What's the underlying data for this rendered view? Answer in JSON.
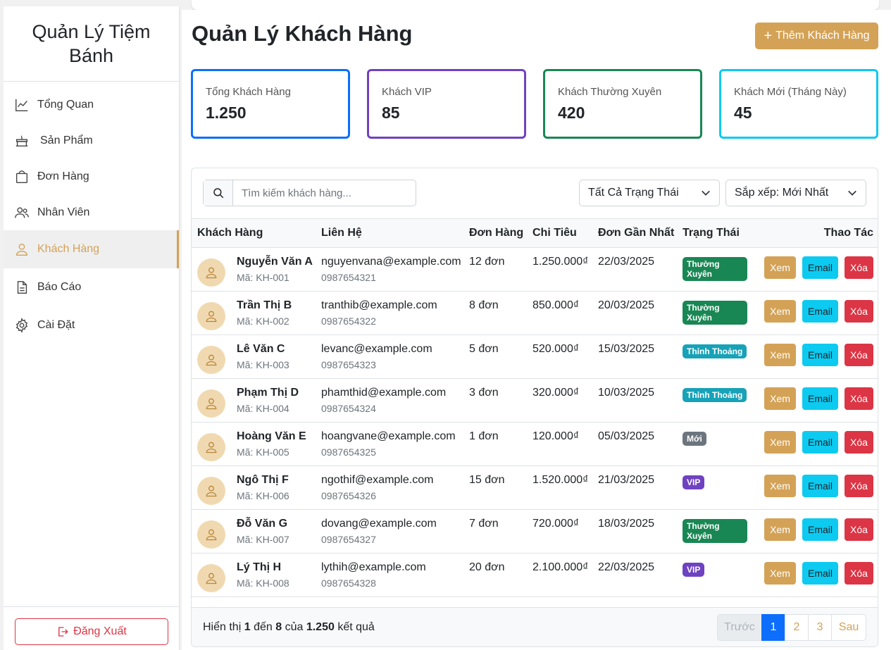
{
  "sidebar": {
    "brand": "Quản Lý Tiệm Bánh",
    "items": [
      {
        "label": "Tổng Quan",
        "icon": "chart-line-icon"
      },
      {
        "label": "Sản Phẩm",
        "icon": "cake-icon"
      },
      {
        "label": "Đơn Hàng",
        "icon": "shopping-bag-icon"
      },
      {
        "label": "Nhân Viên",
        "icon": "users-icon"
      },
      {
        "label": "Khách Hàng",
        "icon": "user-icon",
        "active": true
      },
      {
        "label": "Báo Cáo",
        "icon": "file-icon"
      },
      {
        "label": "Cài Đặt",
        "icon": "gear-icon"
      }
    ],
    "logout_label": "Đăng Xuất"
  },
  "header": {
    "title": "Quản Lý Khách Hàng",
    "add_button_label": "Thêm Khách Hàng"
  },
  "stats": [
    {
      "label": "Tổng Khách Hàng",
      "value": "1.250",
      "color": "#0d6efd"
    },
    {
      "label": "Khách VIP",
      "value": "85",
      "color": "#6f42c1"
    },
    {
      "label": "Khách Thường Xuyên",
      "value": "420",
      "color": "#198754"
    },
    {
      "label": "Khách Mới (Tháng Này)",
      "value": "45",
      "color": "#0dcaf0"
    }
  ],
  "filters": {
    "search_placeholder": "Tìm kiếm khách hàng...",
    "status_select": "Tất Cả Trạng Thái",
    "sort_select": "Sắp xếp: Mới Nhất"
  },
  "table": {
    "headers": [
      "Khách Hàng",
      "Liên Hệ",
      "Đơn Hàng",
      "Chi Tiêu",
      "Đơn Gần Nhất",
      "Trạng Thái",
      "Thao Tác"
    ],
    "action_labels": {
      "view": "Xem",
      "email": "Email",
      "delete": "Xóa"
    },
    "rows": [
      {
        "name": "Nguyễn Văn A",
        "code": "Mã: KH-001",
        "email": "nguyenvana@example.com",
        "phone": "0987654321",
        "orders": "12 đơn",
        "spent": "1.250.000₫",
        "last": "22/03/2025",
        "status": "Thường Xuyên",
        "status_color": "#198754"
      },
      {
        "name": "Trần Thị B",
        "code": "Mã: KH-002",
        "email": "tranthib@example.com",
        "phone": "0987654322",
        "orders": "8 đơn",
        "spent": "850.000₫",
        "last": "20/03/2025",
        "status": "Thường Xuyên",
        "status_color": "#198754"
      },
      {
        "name": "Lê Văn C",
        "code": "Mã: KH-003",
        "email": "levanc@example.com",
        "phone": "0987654323",
        "orders": "5 đơn",
        "spent": "520.000₫",
        "last": "15/03/2025",
        "status": "Thỉnh Thoảng",
        "status_color": "#17a2b8"
      },
      {
        "name": "Phạm Thị D",
        "code": "Mã: KH-004",
        "email": "phamthid@example.com",
        "phone": "0987654324",
        "orders": "3 đơn",
        "spent": "320.000₫",
        "last": "10/03/2025",
        "status": "Thỉnh Thoảng",
        "status_color": "#17a2b8"
      },
      {
        "name": "Hoàng Văn E",
        "code": "Mã: KH-005",
        "email": "hoangvane@example.com",
        "phone": "0987654325",
        "orders": "1 đơn",
        "spent": "120.000₫",
        "last": "05/03/2025",
        "status": "Mới",
        "status_color": "#6c757d"
      },
      {
        "name": "Ngô Thị F",
        "code": "Mã: KH-006",
        "email": "ngothif@example.com",
        "phone": "0987654326",
        "orders": "15 đơn",
        "spent": "1.520.000₫",
        "last": "21/03/2025",
        "status": "VIP",
        "status_color": "#6f42c1"
      },
      {
        "name": "Đỗ Văn G",
        "code": "Mã: KH-007",
        "email": "dovang@example.com",
        "phone": "0987654327",
        "orders": "7 đơn",
        "spent": "720.000₫",
        "last": "18/03/2025",
        "status": "Thường Xuyên",
        "status_color": "#198754"
      },
      {
        "name": "Lý Thị H",
        "code": "Mã: KH-008",
        "email": "lythih@example.com",
        "phone": "0987654328",
        "orders": "20 đơn",
        "spent": "2.100.000₫",
        "last": "22/03/2025",
        "status": "VIP",
        "status_color": "#6f42c1"
      }
    ]
  },
  "footer": {
    "summary_prefix": "Hiển thị",
    "from": "1",
    "word_to": "đến",
    "to": "8",
    "word_of": "của",
    "total": "1.250",
    "suffix": "kết quả",
    "pagination": {
      "prev": "Trước",
      "pages": [
        "1",
        "2",
        "3"
      ],
      "current": "1",
      "next": "Sau"
    }
  },
  "colors": {
    "accent": "#d4a256",
    "primary": "#0d6efd",
    "danger": "#dc3545",
    "info": "#0dcaf0"
  }
}
